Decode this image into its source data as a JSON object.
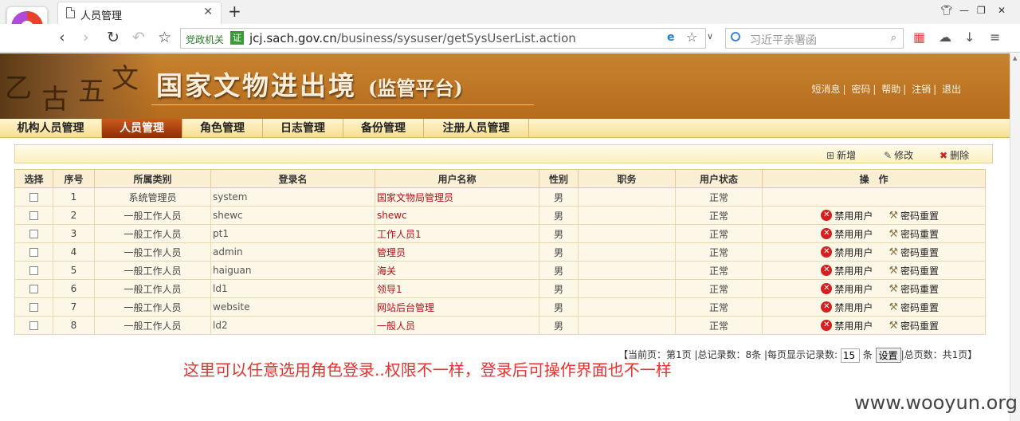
{
  "browser": {
    "tab_title": "人员管理",
    "tab_close": "✕",
    "new_tab": "+",
    "url_badge": "党政机关",
    "url_badge_icon": "证",
    "url_host": "jcj.sach.gov.cn",
    "url_path": "/business/sysuser/getSysUserList.action",
    "search_placeholder": "习近平亲署函",
    "icons": [
      "back-icon",
      "forward-icon",
      "reload-icon",
      "undo-icon",
      "bookmark-star-icon",
      "ie-mode-icon",
      "favorite-star-icon",
      "search-icon",
      "apps-grid-icon",
      "cloud-icon",
      "download-icon",
      "menu-icon"
    ]
  },
  "header": {
    "site_title": "国家文物进出境",
    "site_subtitle": "(监管平台)",
    "links": [
      "短消息",
      "密码",
      "帮助",
      "注销",
      "退出"
    ]
  },
  "menu": {
    "items": [
      "机构人员管理",
      "人员管理",
      "角色管理",
      "日志管理",
      "备份管理",
      "注册人员管理"
    ],
    "active": "人员管理"
  },
  "toolbar": {
    "add_label": "新增",
    "edit_label": "修改",
    "delete_label": "删除"
  },
  "table": {
    "columns": [
      "选择",
      "序号",
      "所属类别",
      "登录名",
      "用户名称",
      "性别",
      "职务",
      "用户状态",
      "操　作"
    ],
    "rows": [
      {
        "seq": "1",
        "category": "系统管理员",
        "login": "system",
        "name": "国家文物局管理员",
        "gender": "男",
        "position": "",
        "status": "正常",
        "ops": false
      },
      {
        "seq": "2",
        "category": "一般工作人员",
        "login": "shewc",
        "name": "shewc",
        "gender": "男",
        "position": "",
        "status": "正常",
        "ops": true
      },
      {
        "seq": "3",
        "category": "一般工作人员",
        "login": "pt1",
        "name": "工作人员1",
        "gender": "男",
        "position": "",
        "status": "正常",
        "ops": true
      },
      {
        "seq": "4",
        "category": "一般工作人员",
        "login": "admin",
        "name": "管理员",
        "gender": "男",
        "position": "",
        "status": "正常",
        "ops": true
      },
      {
        "seq": "5",
        "category": "一般工作人员",
        "login": "haiguan",
        "name": "海关",
        "gender": "男",
        "position": "",
        "status": "正常",
        "ops": true
      },
      {
        "seq": "6",
        "category": "一般工作人员",
        "login": "ld1",
        "name": "领导1",
        "gender": "男",
        "position": "",
        "status": "正常",
        "ops": true
      },
      {
        "seq": "7",
        "category": "一般工作人员",
        "login": "website",
        "name": "网站后台管理",
        "gender": "男",
        "position": "",
        "status": "正常",
        "ops": true
      },
      {
        "seq": "8",
        "category": "一般工作人员",
        "login": "ld2",
        "name": "一般人员",
        "gender": "男",
        "position": "",
        "status": "正常",
        "ops": true
      }
    ],
    "op_disable": "禁用用户",
    "op_reset": "密码重置"
  },
  "pager": {
    "current_page": "【当前页：第1页",
    "total_records": "总记录数：8条",
    "per_page_label": "每页显示记录数:",
    "per_page_value": "15",
    "per_page_unit": "条",
    "set_button": "设置",
    "total_pages": "总页数：共1页】"
  },
  "annotation": "这里可以任意选用角色登录..权限不一样，登录后可操作界面也不一样",
  "watermark": "www.wooyun.org",
  "colors": {
    "banner": "#b56c1d",
    "menu_active": "#a33c0f",
    "name_red": "#b01018",
    "annotation_red": "#e8322e"
  }
}
